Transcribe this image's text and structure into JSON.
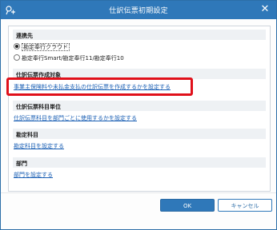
{
  "window": {
    "title": "仕訳伝票初期設定",
    "close_glyph": "✕",
    "icon": "window-app-icon"
  },
  "sections": {
    "renkeisaki": {
      "heading": "連携先",
      "options": [
        {
          "label": "勘定奉行クラウド",
          "selected": true
        },
        {
          "label": "勘定奉行Smart/勘定奉行11/勘定奉行10",
          "selected": false
        }
      ]
    },
    "sakusei": {
      "heading": "仕訳伝票作成対象",
      "link": "事業主保険料や未払金支払の仕訳伝票を作成するかを設定する"
    },
    "kamoku_tani": {
      "heading": "仕訳伝票科目単位",
      "link": "仕訳伝票科目を部門ごとに使用するかを設定する"
    },
    "kanjo": {
      "heading": "勘定科目",
      "link": "勘定科目を設定する"
    },
    "bumon": {
      "heading": "部門",
      "link": "部門を設定する"
    }
  },
  "buttons": {
    "ok": "OK",
    "cancel": "キャンセル"
  },
  "colors": {
    "title_bar": "#2f78b9",
    "link": "#1a5fb4",
    "highlight": "#e0101a"
  }
}
